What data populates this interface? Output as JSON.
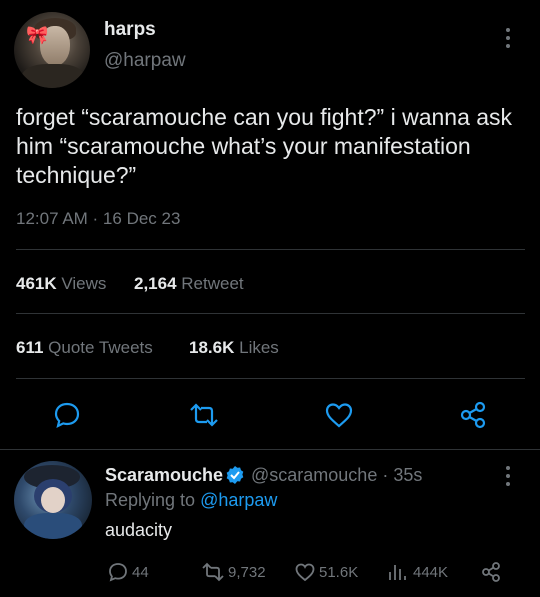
{
  "tweet": {
    "author_name": "harps",
    "author_handle": "@harpaw",
    "text": "forget “scaramouche can you fight?” i wanna ask him “scaramouche what’s your manifestation technique?”",
    "timestamp": "12:07 AM · 16 Dec 23",
    "stats": {
      "views_count": "461K",
      "views_label": "Views",
      "retweets_count": "2,164",
      "retweets_label": "Retweet",
      "quotes_count": "611",
      "quotes_label": "Quote Tweets",
      "likes_count": "18.6K",
      "likes_label": "Likes"
    },
    "actions": [
      "reply-icon",
      "retweet-icon",
      "like-icon",
      "share-icon"
    ]
  },
  "reply": {
    "author_name": "Scaramouche",
    "author_handle": "@scaramouche · 35s",
    "replying_prefix": "Replying to",
    "replying_handle": "@harpaw",
    "text": "audacity",
    "metrics": {
      "replies": "44",
      "retweets": "9,732",
      "likes": "51.6K",
      "views": "444K"
    }
  },
  "colors": {
    "background": "#000000",
    "text": "#e7e9ea",
    "muted": "#71767b",
    "accent": "#1d9bf0",
    "divider": "#2f3336"
  }
}
